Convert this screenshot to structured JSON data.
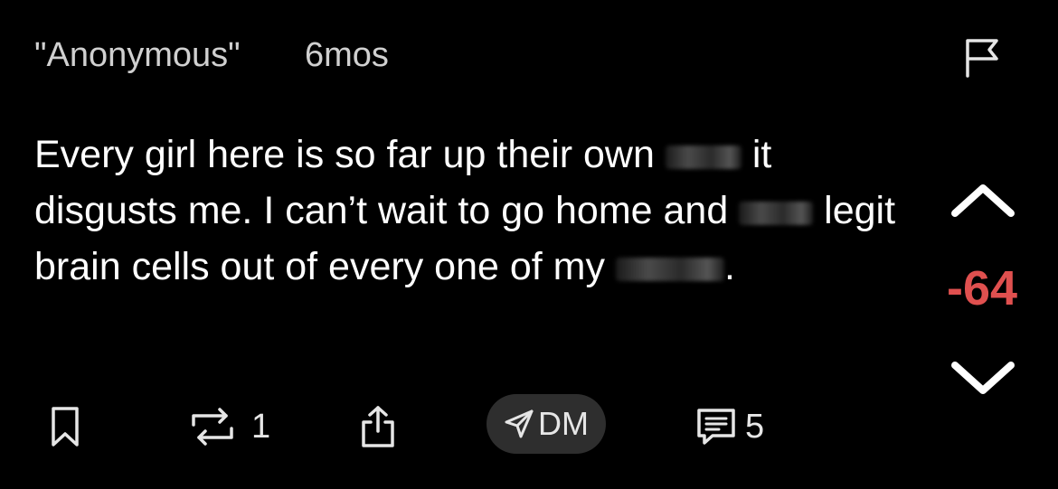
{
  "post": {
    "author": "\"Anonymous\"",
    "time": "6mos",
    "segments": {
      "s1": "Every girl here is so far up their own",
      "s2": "it disgusts me. I can’t wait to go home and",
      "s3": "legit brain cells out of every one of my",
      "s4": "."
    },
    "score": "-64"
  },
  "actions": {
    "repost_count": "1",
    "dm_label": "DM",
    "comment_count": "5"
  },
  "colors": {
    "background": "#000000",
    "text": "#ffffff",
    "score": "#e0504f",
    "dm_pill": "#2e2e2e"
  },
  "icons": [
    "flag-icon",
    "upvote-arrow-icon",
    "downvote-arrow-icon",
    "bookmark-icon",
    "repost-icon",
    "share-icon",
    "send-icon",
    "comment-icon"
  ]
}
